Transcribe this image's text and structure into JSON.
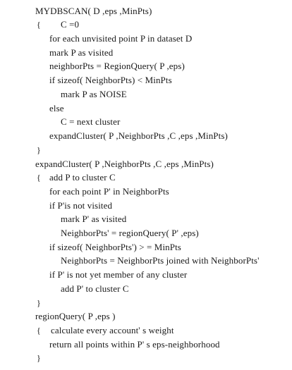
{
  "lines": [
    {
      "brace": "",
      "text": "MYDBSCAN( D ,eps ,MinPts)"
    },
    {
      "brace": "{",
      "text": "C =0"
    },
    {
      "brace": "",
      "text": "for each unvisited point P in dataset D"
    },
    {
      "brace": "",
      "text": "mark P as visited"
    },
    {
      "brace": "",
      "text": "neighborPts = RegionQuery( P ,eps)"
    },
    {
      "brace": "",
      "text": "if sizeof( NeighborPts) < MinPts"
    },
    {
      "brace": "",
      "text": "mark P as NOISE"
    },
    {
      "brace": "",
      "text": "else"
    },
    {
      "brace": "",
      "text": "C = next cluster"
    },
    {
      "brace": "",
      "text": "expandCluster( P ,NeighborPts ,C ,eps ,MinPts)"
    },
    {
      "brace": "}",
      "text": ""
    },
    {
      "brace": "",
      "text": "expandCluster( P ,NeighborPts ,C ,eps ,MinPts)"
    },
    {
      "brace": "{",
      "text": "add P to cluster C"
    },
    {
      "brace": "",
      "text": "for each point P' in NeighborPts"
    },
    {
      "brace": "",
      "text": "if P'is not visited"
    },
    {
      "brace": "",
      "text": "mark P' as visited"
    },
    {
      "brace": "",
      "text": "NeighborPts' = regionQuery( P' ,eps)"
    },
    {
      "brace": "",
      "text": "if sizeof( NeighborPts') > = MinPts"
    },
    {
      "brace": "",
      "text": "NeighborPts = NeighborPts joined with NeighborPts'"
    },
    {
      "brace": "",
      "text": "if P' is not yet member of any cluster"
    },
    {
      "brace": "",
      "text": "add P' to cluster C"
    },
    {
      "brace": "}",
      "text": ""
    },
    {
      "brace": "",
      "text": "regionQuery( P ,eps )"
    },
    {
      "brace": "{",
      "text": "calculate every account' s weight"
    },
    {
      "brace": "",
      "text": "return all points within P' s eps-neighborhood"
    },
    {
      "brace": "}",
      "text": ""
    }
  ]
}
